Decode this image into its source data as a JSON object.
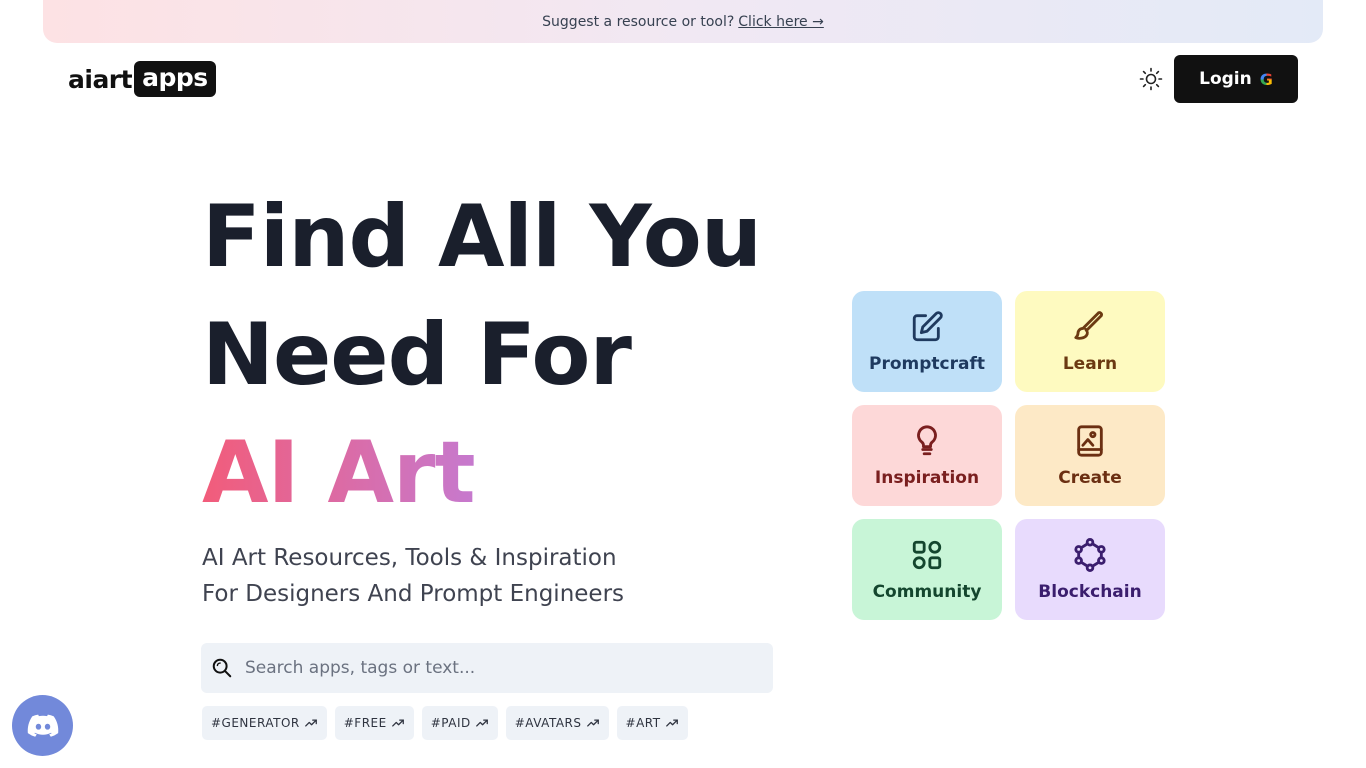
{
  "banner": {
    "text": "Suggest a resource or tool?",
    "link": "Click here →"
  },
  "logo": {
    "part1": "aiart",
    "part2": "apps"
  },
  "header": {
    "login_label": "Login",
    "google_mark": "G"
  },
  "hero": {
    "line1": "Find All You",
    "line2": "Need For",
    "line3": "AI Art",
    "subtitle_line1": "AI Art Resources, Tools & Inspiration",
    "subtitle_line2": "For Designers And Prompt Engineers"
  },
  "search": {
    "placeholder": "Search apps, tags or text..."
  },
  "tags": [
    "#GENERATOR",
    "#FREE",
    "#PAID",
    "#AVATARS",
    "#ART"
  ],
  "categories": [
    {
      "label": "Promptcraft",
      "icon": "edit-icon",
      "bg": "#bfe0f8",
      "fg": "#1f3a5f"
    },
    {
      "label": "Learn",
      "icon": "brush-icon",
      "bg": "#fefac0",
      "fg": "#6b3a12"
    },
    {
      "label": "Inspiration",
      "icon": "lightbulb-icon",
      "bg": "#fdd8d8",
      "fg": "#7a1f1f"
    },
    {
      "label": "Create",
      "icon": "image-book-icon",
      "bg": "#fde9c6",
      "fg": "#6b2f12"
    },
    {
      "label": "Community",
      "icon": "grid-shapes-icon",
      "bg": "#c8f5d7",
      "fg": "#14462e"
    },
    {
      "label": "Blockchain",
      "icon": "network-icon",
      "bg": "#e8dbfd",
      "fg": "#3b1e6e"
    }
  ],
  "colors": {
    "accent_dark": "#111111",
    "search_bg": "#eef2f7",
    "discord": "#7289da"
  }
}
